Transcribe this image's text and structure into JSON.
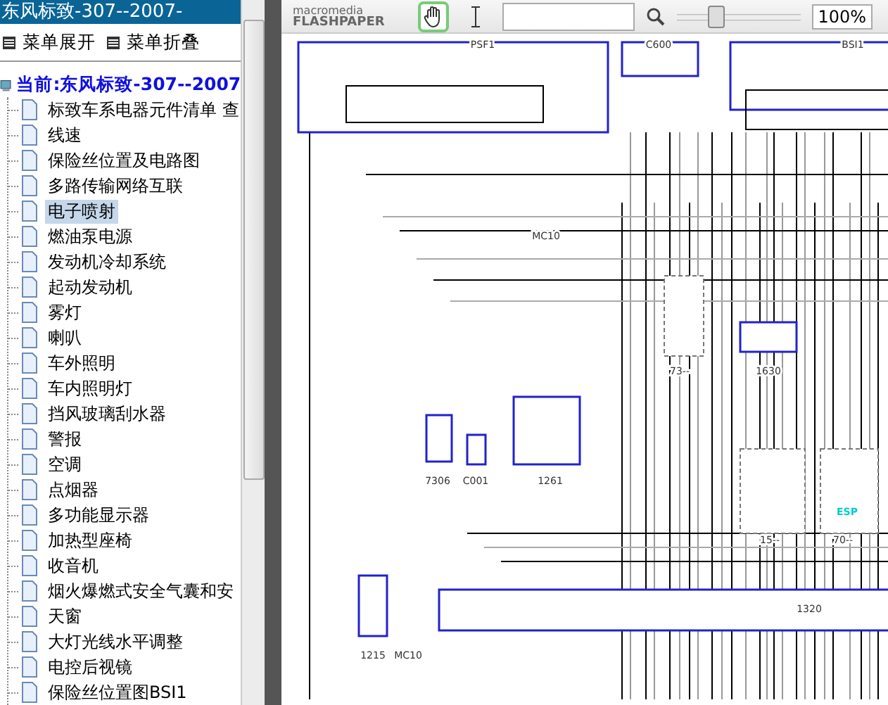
{
  "sidebar": {
    "title": "东风标致-307--2007-",
    "menu_buttons": [
      "菜单展开",
      "菜单折叠"
    ],
    "tree": {
      "label": "当前:东风标致-307--2007",
      "children": [
        {
          "label": "标致车系电器元件清单 查",
          "selected": false
        },
        {
          "label": "线速",
          "selected": false
        },
        {
          "label": "保险丝位置及电路图",
          "selected": false
        },
        {
          "label": "多路传输网络互联",
          "selected": false
        },
        {
          "label": "电子喷射",
          "selected": true
        },
        {
          "label": "燃油泵电源",
          "selected": false
        },
        {
          "label": "发动机冷却系统",
          "selected": false
        },
        {
          "label": "起动发动机",
          "selected": false
        },
        {
          "label": "雾灯",
          "selected": false
        },
        {
          "label": "喇叭",
          "selected": false
        },
        {
          "label": "车外照明",
          "selected": false
        },
        {
          "label": "车内照明灯",
          "selected": false
        },
        {
          "label": "挡风玻璃刮水器",
          "selected": false
        },
        {
          "label": "警报",
          "selected": false
        },
        {
          "label": "空调",
          "selected": false
        },
        {
          "label": "点烟器",
          "selected": false
        },
        {
          "label": "多功能显示器",
          "selected": false
        },
        {
          "label": "加热型座椅",
          "selected": false
        },
        {
          "label": "收音机",
          "selected": false
        },
        {
          "label": "烟火爆燃式安全气囊和安",
          "selected": false
        },
        {
          "label": "天窗",
          "selected": false
        },
        {
          "label": "大灯光线水平调整",
          "selected": false
        },
        {
          "label": "电控后视镜",
          "selected": false
        },
        {
          "label": "保险丝位置图BSI1",
          "selected": false
        }
      ]
    }
  },
  "toolbar": {
    "logo_top": "macromedia",
    "logo_bottom": "FLASHPAPER",
    "tools": [
      {
        "kind": "hand",
        "selected": true
      },
      {
        "kind": "text",
        "selected": false
      }
    ],
    "zoom": {
      "level": 0.3,
      "value": "100%"
    }
  },
  "diagram": {
    "labels": [
      "PSF1",
      "C600",
      "BSI1",
      "MC10",
      "73--",
      "1630",
      "7306",
      "C001",
      "1261",
      "15--",
      "70--",
      "ESP",
      "1320",
      "1215",
      "MC10"
    ]
  }
}
